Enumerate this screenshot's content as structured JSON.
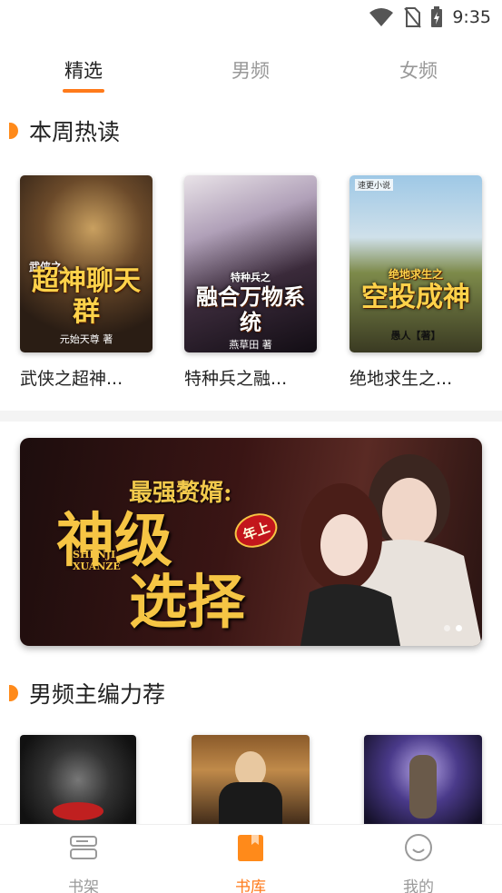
{
  "status_bar": {
    "time": "9:35",
    "icons": [
      "wifi-icon",
      "no-sim-icon",
      "battery-charging-icon"
    ]
  },
  "top_tabs": [
    {
      "label": "精选",
      "active": true
    },
    {
      "label": "男频",
      "active": false
    },
    {
      "label": "女频",
      "active": false
    }
  ],
  "sections": {
    "hot_weekly": {
      "title": "本周热读"
    },
    "male_picks": {
      "title": "男频主编力荐"
    }
  },
  "hot_books": [
    {
      "name": "武侠之超神...",
      "cover_text": "超神聊天群",
      "cover_prefix": "武侠之",
      "cover_author": "元始天尊 著"
    },
    {
      "name": "特种兵之融...",
      "cover_text": "融合万物系统",
      "cover_prefix": "特种兵之",
      "cover_author": "燕草田 著"
    },
    {
      "name": "绝地求生之...",
      "cover_text": "空投成神",
      "cover_prefix": "绝地求生之",
      "cover_author": "愚人【著】",
      "cover_tag": "速更小说"
    }
  ],
  "banner": {
    "subtitle": "最强赘婿:",
    "title_line1": "神级",
    "title_line2": "选择",
    "badge": "年上",
    "pinyin_line1": "SHENJI",
    "pinyin_line2": "XUANZE"
  },
  "male_books": [
    {
      "cover_text": ""
    },
    {
      "cover_text": ""
    },
    {
      "cover_text": ""
    }
  ],
  "bottom_nav": [
    {
      "label": "书架",
      "icon": "bookshelf-icon",
      "active": false
    },
    {
      "label": "书库",
      "icon": "library-icon",
      "active": true
    },
    {
      "label": "我的",
      "icon": "profile-icon",
      "active": false
    }
  ],
  "colors": {
    "accent": "#ff7a1a",
    "inactive": "#999999",
    "text": "#222222"
  }
}
